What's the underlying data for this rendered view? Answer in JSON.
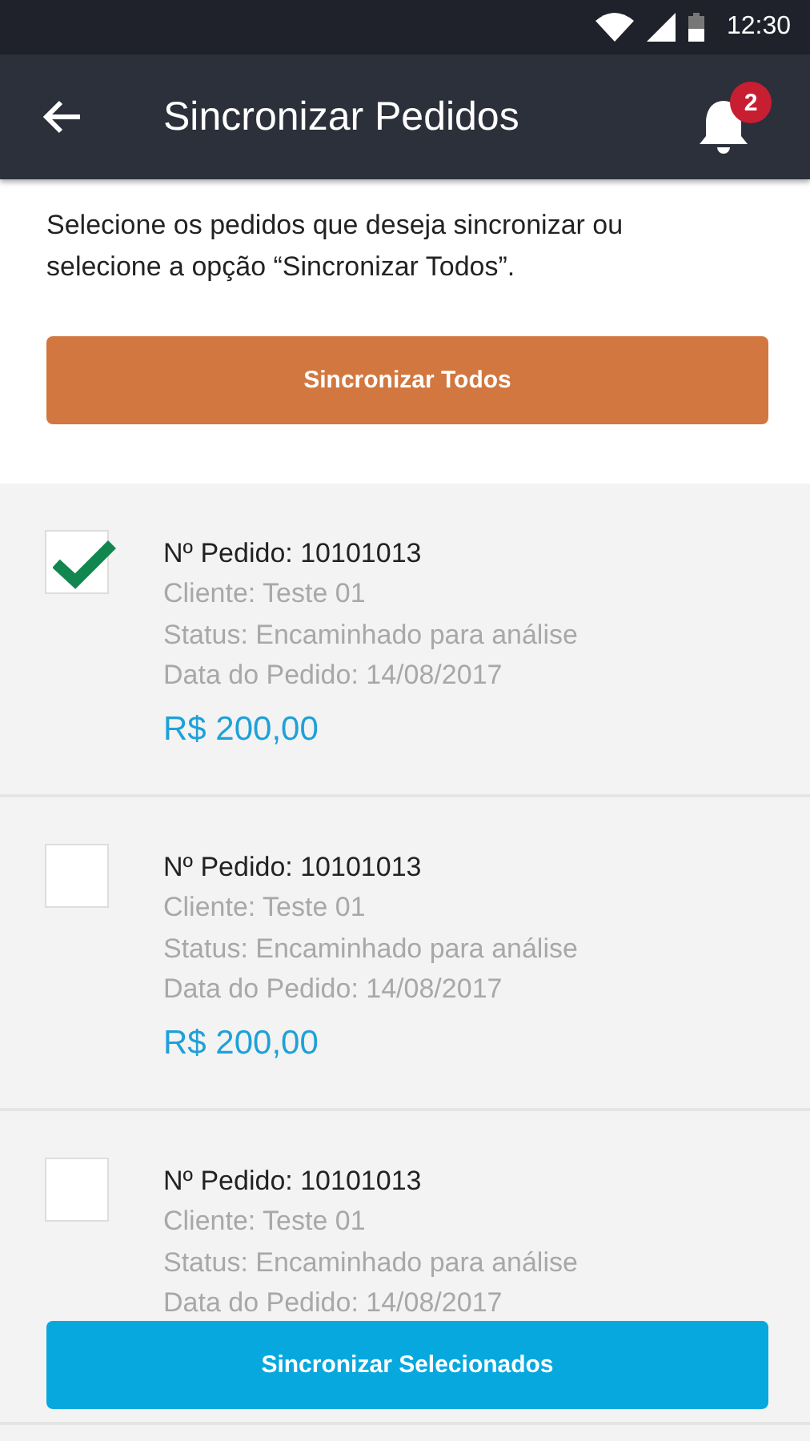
{
  "status_bar": {
    "time": "12:30"
  },
  "app_bar": {
    "title": "Sincronizar Pedidos",
    "notifications": {
      "count": "2"
    }
  },
  "intro": "Selecione os pedidos que deseja sincronizar ou selecione a opção “Sincronizar Todos”.",
  "sync_all_button": "Sincronizar Todos",
  "orders": [
    {
      "checked": true,
      "number": "Nº Pedido: 10101013",
      "client": "Cliente: Teste 01",
      "status": "Status: Encaminhado para análise",
      "date": "Data do Pedido: 14/08/2017",
      "total": "R$ 200,00"
    },
    {
      "checked": false,
      "number": "Nº Pedido: 10101013",
      "client": "Cliente: Teste 01",
      "status": "Status: Encaminhado para análise",
      "date": "Data do Pedido: 14/08/2017",
      "total": "R$ 200,00"
    },
    {
      "checked": false,
      "number": "Nº Pedido: 10101013",
      "client": "Cliente: Teste 01",
      "status": "Status: Encaminhado para análise",
      "date": "Data do Pedido: 14/08/2017"
    }
  ],
  "sync_selected_button": "Sincronizar Selecionados"
}
